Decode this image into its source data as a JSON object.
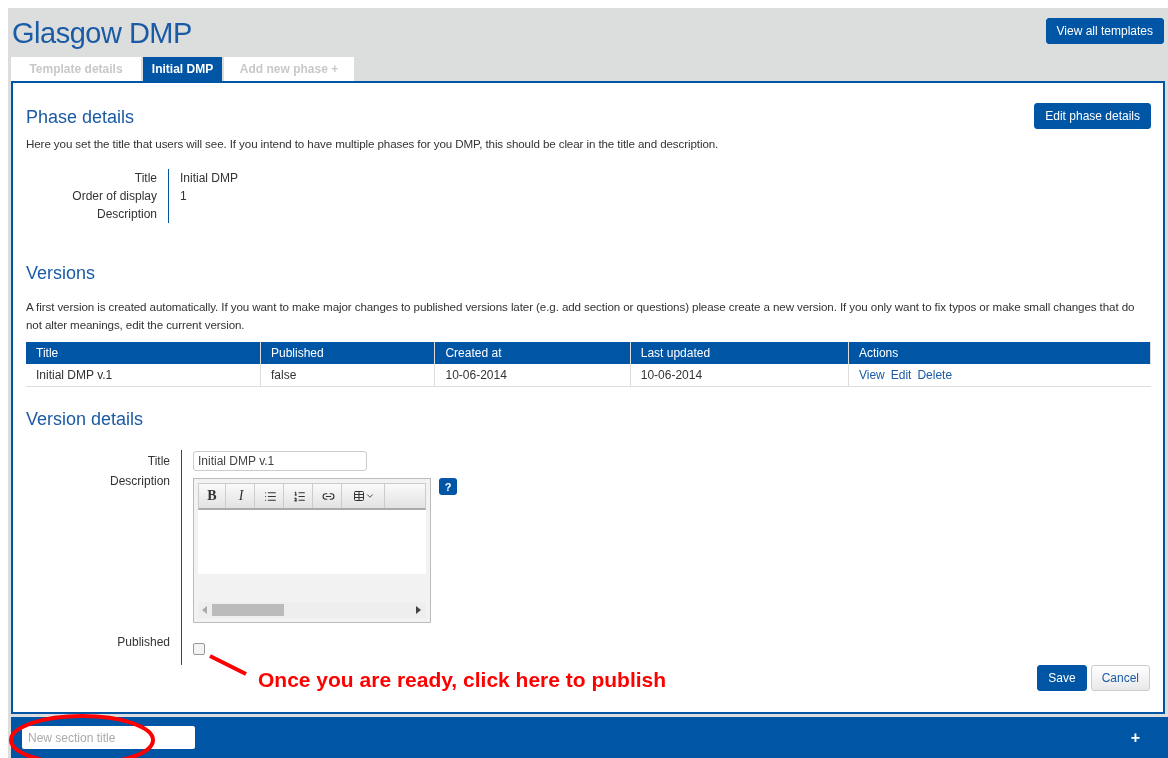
{
  "header": {
    "title": "Glasgow DMP",
    "view_all_button": "View all templates"
  },
  "tabs": [
    {
      "label": "Template details",
      "selected": false
    },
    {
      "label": "Initial DMP",
      "selected": true
    },
    {
      "label": "Add new phase +",
      "selected": false
    }
  ],
  "phase_details": {
    "heading": "Phase details",
    "edit_button": "Edit phase details",
    "intro": "Here you set the title that users will see. If you intend to have multiple phases for you DMP, this should be clear in the title and description.",
    "fields": [
      {
        "label": "Title",
        "value": "Initial DMP"
      },
      {
        "label": "Order of display",
        "value": "1"
      },
      {
        "label": "Description"
      }
    ]
  },
  "versions": {
    "heading": "Versions",
    "intro": "A first version is created automatically. If you want to make major changes to published versions later (e.g. add section or questions) please create a new version. If you only want to fix typos or make small changes that do not alter meanings, edit the current version.",
    "table": {
      "columns": [
        "Title",
        "Published",
        "Created at",
        "Last updated",
        "Actions"
      ],
      "rows": [
        {
          "cells": [
            "Initial DMP v.1",
            "false",
            "10-06-2014",
            "10-06-2014"
          ],
          "actions": [
            "View",
            "Edit",
            "Delete"
          ]
        }
      ]
    }
  },
  "version_details": {
    "heading": "Version details",
    "title_label": "Title",
    "title_value": "Initial DMP v.1",
    "description_label": "Description",
    "editor_buttons": [
      {
        "kind": "bold",
        "label": "B"
      },
      {
        "kind": "italic",
        "label": "I"
      }
    ],
    "help": "?",
    "published_label": "Published",
    "published_checked": false,
    "save_button": "Save",
    "cancel_button": "Cancel"
  },
  "annotation": "Once you are ready, click here to publish",
  "section_bar": {
    "placeholder": "New section title",
    "add": "+"
  }
}
